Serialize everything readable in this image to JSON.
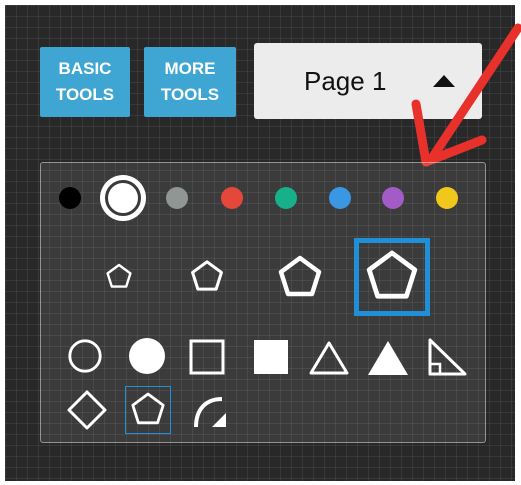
{
  "toolbar": {
    "basic_tools": {
      "line1": "BASIC",
      "line2": "TOOLS"
    },
    "more_tools": {
      "line1": "MORE",
      "line2": "TOOLS"
    },
    "page_selector": {
      "label": "Page 1"
    }
  },
  "palette": {
    "colors": [
      {
        "name": "black",
        "hex": "#000000"
      },
      {
        "name": "white",
        "hex": "#ffffff",
        "selected": true
      },
      {
        "name": "gray",
        "hex": "#8f9694"
      },
      {
        "name": "red",
        "hex": "#e5473b"
      },
      {
        "name": "green",
        "hex": "#17b08a"
      },
      {
        "name": "blue",
        "hex": "#3b97e3"
      },
      {
        "name": "purple",
        "hex": "#a35cc7"
      },
      {
        "name": "yellow",
        "hex": "#f0c81c"
      }
    ],
    "sizes": [
      "small",
      "medium",
      "large",
      "extra-large"
    ],
    "selected_size": "extra-large",
    "shapes": [
      "circle-outline",
      "circle-filled",
      "square-outline",
      "square-filled",
      "triangle-outline",
      "triangle-filled",
      "right-triangle",
      "diamond",
      "pentagon",
      "arc-arrow"
    ],
    "selected_shape": "pentagon",
    "accent_color": "#1f8fd8"
  },
  "annotation": {
    "arrow_color": "#e8312b"
  }
}
